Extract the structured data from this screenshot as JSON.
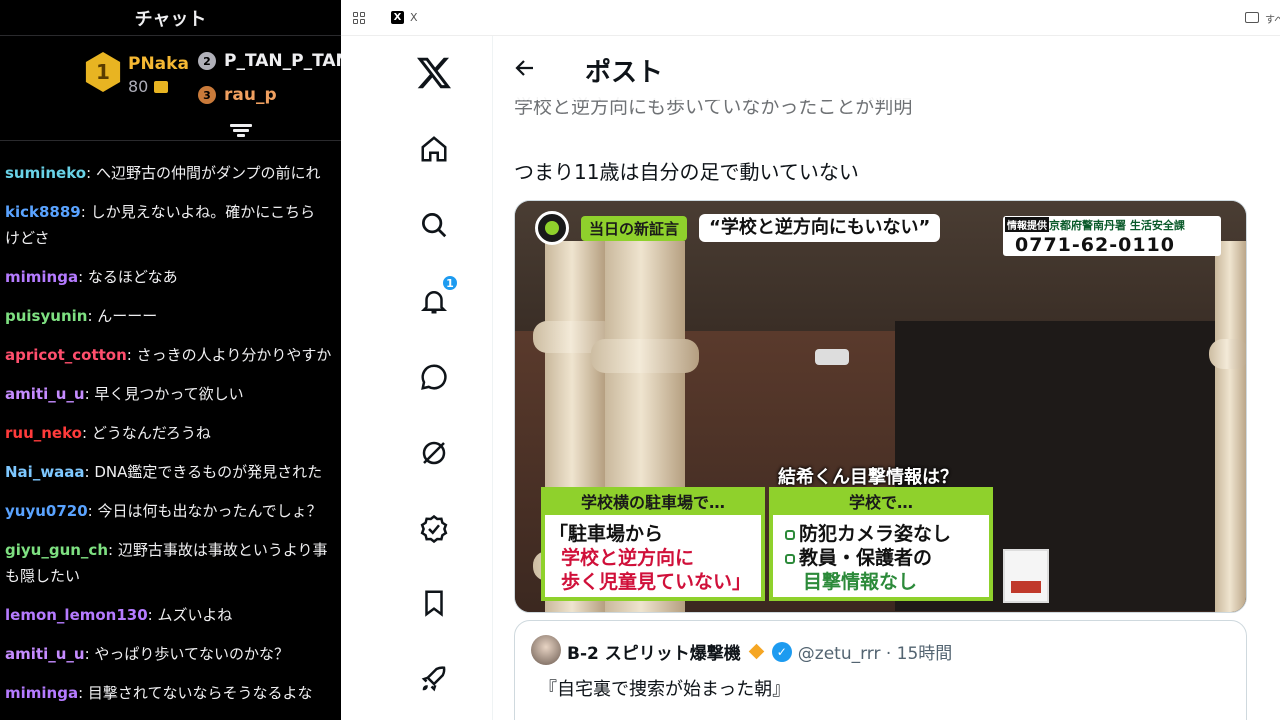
{
  "chat": {
    "title": "チャット",
    "leaderboard": {
      "first": {
        "rank": "1",
        "name": "PNaka",
        "score": "80"
      },
      "second": {
        "rank": "2",
        "name": "P_TAN_P_TAN"
      },
      "third": {
        "rank": "3",
        "name": "rau_p"
      }
    },
    "messages": [
      {
        "user": "sumineko",
        "color": "#69d2e7",
        "text": "へ辺野古の仲間がダンプの前にれ"
      },
      {
        "user": "kick8889",
        "color": "#5aa3ff",
        "text": "しか見えないよね。確かにこちら",
        "cont": "けどさ"
      },
      {
        "user": "miminga",
        "color": "#b57bff",
        "text": "なるほどなあ"
      },
      {
        "user": "puisyunin",
        "color": "#7ee081",
        "text": "んーーー"
      },
      {
        "user": "apricot_cotton",
        "color": "#ff4f6d",
        "text": "さっきの人より分かりやすか"
      },
      {
        "user": "amiti_u_u",
        "color": "#c58cff",
        "text": "早く見つかって欲しい"
      },
      {
        "user": "ruu_neko",
        "color": "#ff3b3b",
        "text": "どうなんだろうね"
      },
      {
        "user": "Nai_waaa",
        "color": "#7ec8ff",
        "text": "DNA鑑定できるものが発見された"
      },
      {
        "user": "yuyu0720",
        "color": "#5aa3ff",
        "text": "今日は何も出なかったんでしょ？"
      },
      {
        "user": "giyu_gun_ch",
        "color": "#7ee081",
        "text": "辺野古事故は事故というより事",
        "cont": "も隠したい"
      },
      {
        "user": "lemon_lemon130",
        "color": "#b57bff",
        "text": "ムズいよね"
      },
      {
        "user": "amiti_u_u",
        "color": "#c58cff",
        "text": "やっぱり歩いてないのかな？"
      },
      {
        "user": "miminga",
        "color": "#b57bff",
        "text": "目撃されてないならそうなるよな"
      }
    ]
  },
  "browser": {
    "tab_title": "X",
    "bookmarks_label": "すべ"
  },
  "x": {
    "notifications_count": "1",
    "post_title": "ポスト",
    "cut_text": "学校と逆方向にも歩いていなかったことが判明",
    "body_text": "つまり11歳は自分の足で動いていない",
    "media": {
      "tag": "当日の新証言",
      "headline": "“学校と逆方向にもいない”",
      "source_label": "情報提供",
      "source_org": "京都府警南丹署 生活安全課",
      "phone": "0771-62-0110",
      "question": "結希くん目撃情報は？",
      "left_box": {
        "head": "学校横の駐車場で…",
        "line1": "「駐車場から",
        "line2": "学校と逆方向に",
        "line3": "歩く児童見ていない」"
      },
      "right_box": {
        "head": "学校で…",
        "line1": "防犯カメラ姿なし",
        "line2": "教員・保護者の",
        "line3": "目撃情報なし"
      }
    },
    "quote": {
      "name": "B-2 スピリット爆撃機",
      "handle": "@zetu_rrr · 15時間",
      "text": "『自宅裏で捜索が始まった朝』"
    }
  }
}
